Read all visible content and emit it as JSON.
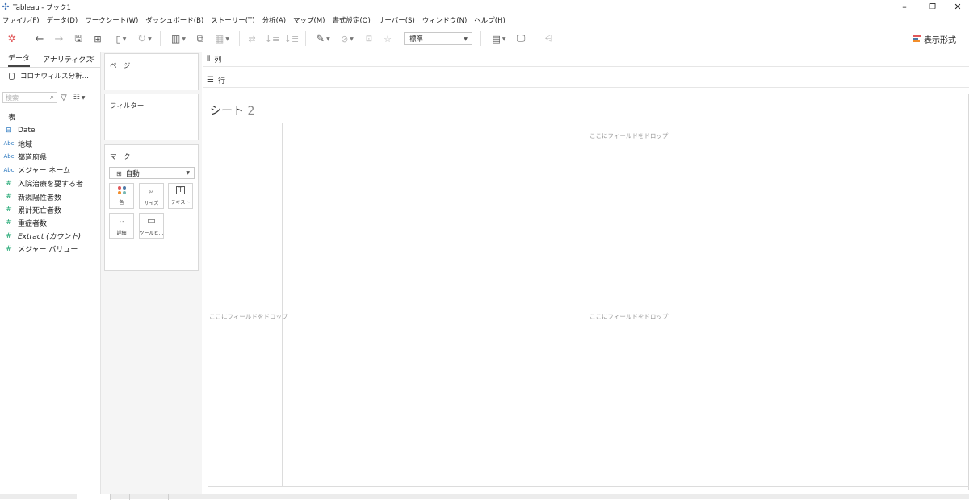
{
  "window": {
    "title": "Tableau - ブック1",
    "controls": [
      "–",
      "❐",
      "✕"
    ]
  },
  "menu": [
    "ファイル(F)",
    "データ(D)",
    "ワークシート(W)",
    "ダッシュボード(B)",
    "ストーリー(T)",
    "分析(A)",
    "マップ(M)",
    "書式設定(O)",
    "サーバー(S)",
    "ウィンドウ(N)",
    "ヘルプ(H)"
  ],
  "toolbar": {
    "fit_value": "標準",
    "show_me_label": "表示形式",
    "show_me_colors": [
      "#e15759",
      "#4e79a7",
      "#f28e2b"
    ]
  },
  "data_pane": {
    "tabs": [
      "データ",
      "アナリティクス"
    ],
    "collapse": "<",
    "datasource": "コロナウィルス分析…",
    "search_placeholder": "検索",
    "section": "表",
    "fields": [
      {
        "icon": "calendar",
        "icon_text": "⊟",
        "kind": "cal",
        "name": "Date"
      },
      {
        "icon": "abc",
        "icon_text": "Abc",
        "kind": "dim",
        "name": "地域"
      },
      {
        "icon": "abc",
        "icon_text": "Abc",
        "kind": "dim",
        "name": "都道府県"
      },
      {
        "icon": "abc",
        "icon_text": "Abc",
        "kind": "dim",
        "name": "メジャー ネーム"
      },
      {
        "icon": "hash",
        "icon_text": "#",
        "kind": "measure",
        "name": "入院治療を要する者"
      },
      {
        "icon": "hash",
        "icon_text": "#",
        "kind": "measure",
        "name": "新規陽性者数"
      },
      {
        "icon": "hash",
        "icon_text": "#",
        "kind": "measure",
        "name": "累計死亡者数"
      },
      {
        "icon": "hash",
        "icon_text": "#",
        "kind": "measure",
        "name": "重症者数"
      },
      {
        "icon": "hash",
        "icon_text": "#",
        "kind": "measure",
        "name": "Extract (カウント)",
        "italic": true
      },
      {
        "icon": "hash",
        "icon_text": "#",
        "kind": "measure",
        "name": "メジャー バリュー"
      }
    ]
  },
  "cards": {
    "pages": "ページ",
    "filters": "フィルター",
    "marks": "マーク",
    "mark_type": "自動",
    "mark_buttons": {
      "color": "色",
      "size": "サイズ",
      "label": "テキスト",
      "detail": "詳細",
      "tooltip": "ツールヒ…"
    },
    "color_dots": [
      "#e15759",
      "#4e79a7",
      "#f28e2b",
      "#76b7b2"
    ]
  },
  "shelves": {
    "columns": "列",
    "rows": "行"
  },
  "sheet": {
    "title": "シート",
    "number": "2",
    "drop_top": "ここにフィールドをドロップ",
    "drop_left": "ここにフィールドをドロップ",
    "drop_center": "ここにフィールドをドロップ"
  }
}
